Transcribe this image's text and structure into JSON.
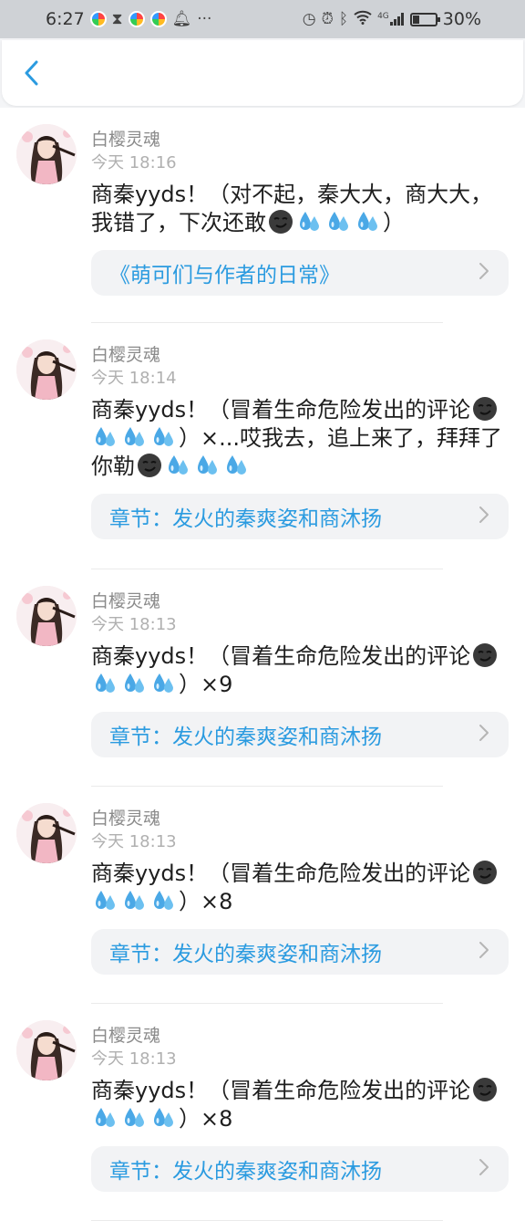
{
  "status_bar": {
    "time": "6:27",
    "network": "4G",
    "battery_percent": "30%",
    "battery_level": 0.3
  },
  "header": {
    "back_icon": "chevron-left-icon"
  },
  "comments": [
    {
      "username": "白樱灵魂",
      "time": "今天 18:16",
      "segments": [
        {
          "t": "商秦yyds！（对不起，秦大大，商大大，我错了，下次还敢"
        },
        {
          "e": "smirk"
        },
        {
          "e": "sweat"
        },
        {
          "e": "sweat"
        },
        {
          "e": "sweat"
        },
        {
          "t": "）"
        }
      ],
      "link": "《萌可们与作者的日常》"
    },
    {
      "username": "白樱灵魂",
      "time": "今天 18:14",
      "segments": [
        {
          "t": "商秦yyds！（冒着生命危险发出的评论"
        },
        {
          "e": "smirk"
        },
        {
          "e": "sweat"
        },
        {
          "e": "sweat"
        },
        {
          "e": "sweat"
        },
        {
          "t": "）×...哎我去，追上来了，拜拜了你勒"
        },
        {
          "e": "smirk"
        },
        {
          "e": "sweat"
        },
        {
          "e": "sweat"
        },
        {
          "e": "sweat"
        }
      ],
      "link": "章节：发火的秦爽姿和商沐扬"
    },
    {
      "username": "白樱灵魂",
      "time": "今天 18:13",
      "segments": [
        {
          "t": "商秦yyds！（冒着生命危险发出的评论"
        },
        {
          "e": "smirk"
        },
        {
          "e": "sweat"
        },
        {
          "e": "sweat"
        },
        {
          "e": "sweat"
        },
        {
          "t": "）×9"
        }
      ],
      "link": "章节：发火的秦爽姿和商沐扬"
    },
    {
      "username": "白樱灵魂",
      "time": "今天 18:13",
      "segments": [
        {
          "t": "商秦yyds！（冒着生命危险发出的评论"
        },
        {
          "e": "smirk"
        },
        {
          "e": "sweat"
        },
        {
          "e": "sweat"
        },
        {
          "e": "sweat"
        },
        {
          "t": "）×8"
        }
      ],
      "link": "章节：发火的秦爽姿和商沐扬"
    },
    {
      "username": "白樱灵魂",
      "time": "今天 18:13",
      "segments": [
        {
          "t": "商秦yyds！（冒着生命危险发出的评论"
        },
        {
          "e": "smirk"
        },
        {
          "e": "sweat"
        },
        {
          "e": "sweat"
        },
        {
          "e": "sweat"
        },
        {
          "t": "）×8"
        }
      ],
      "link": "章节：发火的秦爽姿和商沐扬"
    }
  ],
  "colors": {
    "link": "#2b9be0",
    "background": "#f4f5f7"
  }
}
